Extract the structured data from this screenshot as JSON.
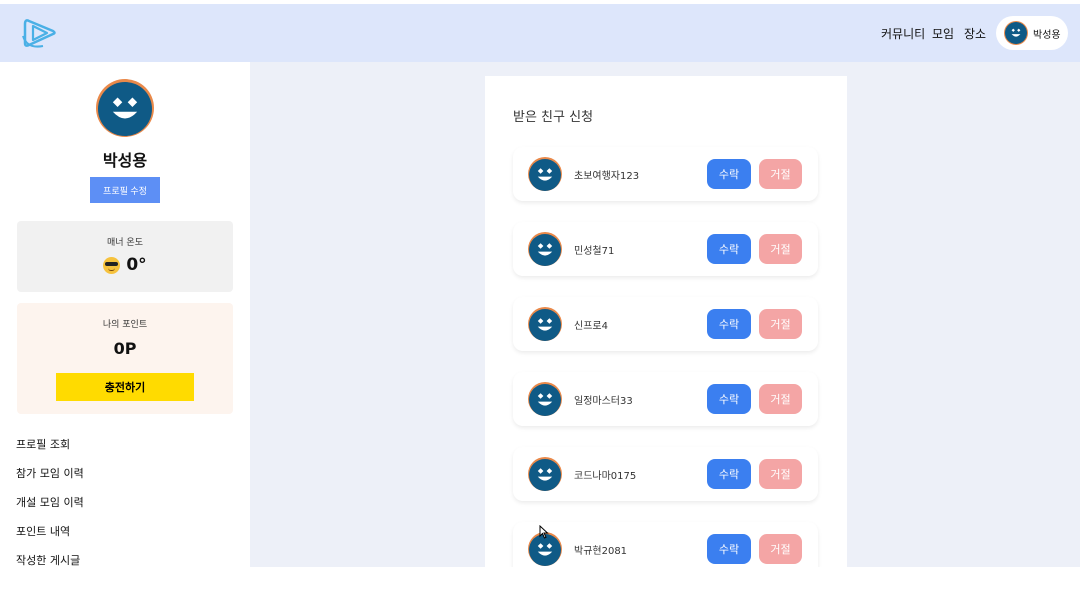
{
  "header": {
    "nav": [
      "커뮤니티",
      "모임",
      "장소"
    ],
    "user_name": "박성용"
  },
  "sidebar": {
    "profile_name": "박성용",
    "edit_profile_label": "프로필 수정",
    "manner": {
      "title": "매너 온도",
      "value": "0°",
      "icon": "sunglasses-emoji-icon"
    },
    "points": {
      "title": "나의 포인트",
      "value": "0P",
      "charge_label": "충전하기"
    },
    "menu": [
      "프로필 조회",
      "참가 모임 이력",
      "개설 모임 이력",
      "포인트 내역",
      "작성한 게시글"
    ]
  },
  "main": {
    "panel_title": "받은 친구 신청",
    "accept_label": "수락",
    "reject_label": "거절",
    "requests": [
      {
        "name": "초보여행자123"
      },
      {
        "name": "민성철71"
      },
      {
        "name": "신프로4"
      },
      {
        "name": "일정마스터33"
      },
      {
        "name": "코드나마0175"
      },
      {
        "name": "박규현2081"
      }
    ]
  },
  "colors": {
    "header_bg": "#dde6fb",
    "main_bg": "#edf0f8",
    "accept": "#3b7ff0",
    "reject": "#f4a5a5",
    "charge": "#ffdb00",
    "edit": "#5d8ff5",
    "avatar_ring": "#e9894a",
    "avatar_face": "#0f5a86"
  }
}
